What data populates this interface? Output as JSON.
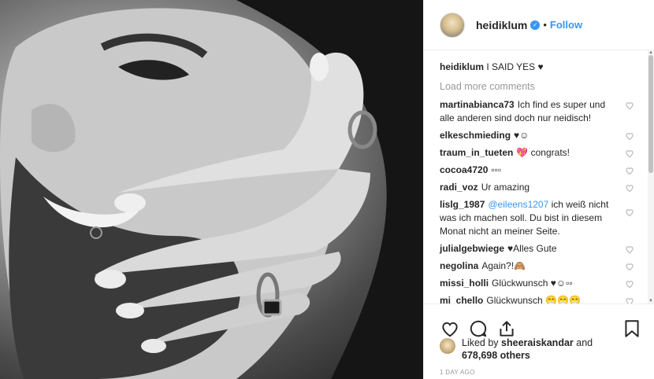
{
  "post": {
    "username": "heidiklum",
    "follow_label": "Follow",
    "separator": "•",
    "verified_glyph": "✓",
    "caption_user": "heidiklum",
    "caption_text": "I SAID YES ♥",
    "load_more": "Load more comments",
    "comments": [
      {
        "user": "martinabianca73",
        "text": "Ich find es super und alle anderen sind doch nur neidisch!"
      },
      {
        "user": "elkeschmieding",
        "text": "♥☺"
      },
      {
        "user": "traum_in_tueten",
        "text": "💖 congrats!"
      },
      {
        "user": "cocoa4720",
        "text": "▫▫▫"
      },
      {
        "user": "radi_voz",
        "text": "Ur amazing"
      },
      {
        "user": "lislg_1987",
        "mention": "@eileens1207",
        "text": " ich weiß nicht was ich machen soll. Du bist in diesem Monat nicht an meiner Seite."
      },
      {
        "user": "julialgebwiege",
        "text": "♥Alles Gute"
      },
      {
        "user": "negolina",
        "text": "Again?!🙈"
      },
      {
        "user": "missi_holli",
        "text": "Glückwunsch ♥☺▫▫"
      },
      {
        "user": "mi_chello",
        "text": "Glückwunsch 😁😁😁"
      }
    ],
    "likes": {
      "prefix": "Liked by",
      "user": "sheeraiskandar",
      "mid": "and",
      "count": "678,698",
      "suffix": "others"
    },
    "timestamp": "1 DAY AGO"
  },
  "icons": [
    "heart-icon",
    "comment-icon",
    "share-icon",
    "bookmark-icon",
    "verified-badge-icon"
  ]
}
